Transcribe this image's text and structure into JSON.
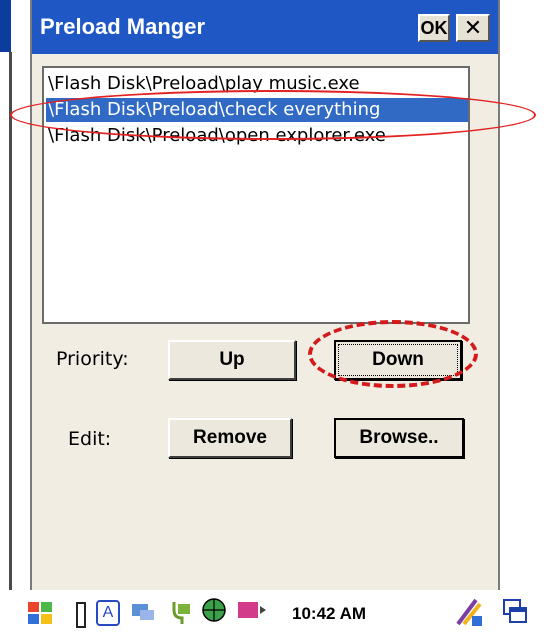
{
  "window": {
    "title": "Preload Manger",
    "ok_label": "OK",
    "close_label": "✕"
  },
  "list": {
    "items": [
      {
        "path": "\\Flash Disk\\Preload\\play music.exe",
        "selected": false
      },
      {
        "path": "\\Flash Disk\\Preload\\check everything",
        "selected": true
      },
      {
        "path": "\\Flash Disk\\Preload\\open explorer.exe",
        "selected": false
      }
    ]
  },
  "priority": {
    "label": "Priority:",
    "up_label": "Up",
    "down_label": "Down"
  },
  "edit": {
    "label": "Edit:",
    "remove_label": "Remove",
    "browse_label": "Browse.."
  },
  "taskbar": {
    "time": "10:42 AM",
    "input_indicator": "A"
  },
  "colors": {
    "titlebar": "#1f58c5",
    "selection": "#316ac5",
    "annotation": "#e32121"
  }
}
